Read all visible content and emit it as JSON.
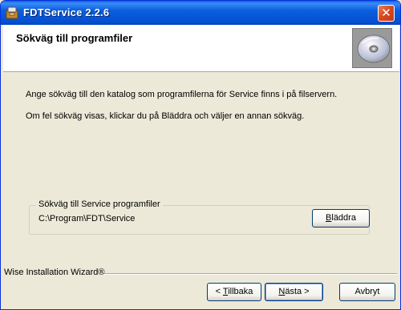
{
  "window": {
    "title": "FDTService 2.2.6",
    "close_glyph": "✕"
  },
  "header": {
    "title": "Sökväg till programfiler",
    "image_icon": "cd-disc-icon"
  },
  "body": {
    "line1": "Ange sökväg till den katalog som programfilerna för Service finns i på filservern.",
    "line2": "Om fel sökväg visas, klickar du på Bläddra och väljer en annan sökväg."
  },
  "path_group": {
    "legend": "Sökväg till Service programfiler",
    "path": "C:\\Program\\FDT\\Service",
    "browse_label_u": "B",
    "browse_label_rest": "läddra"
  },
  "footer": {
    "wizard_label": "Wise Installation Wizard®",
    "back_prefix": "< ",
    "back_u": "T",
    "back_rest": "illbaka",
    "next_u": "N",
    "next_rest": "ästa >",
    "cancel_label": "Avbryt"
  },
  "colors": {
    "titlebar": "#0a5fde",
    "face": "#ece9d8",
    "close": "#d9461f"
  }
}
